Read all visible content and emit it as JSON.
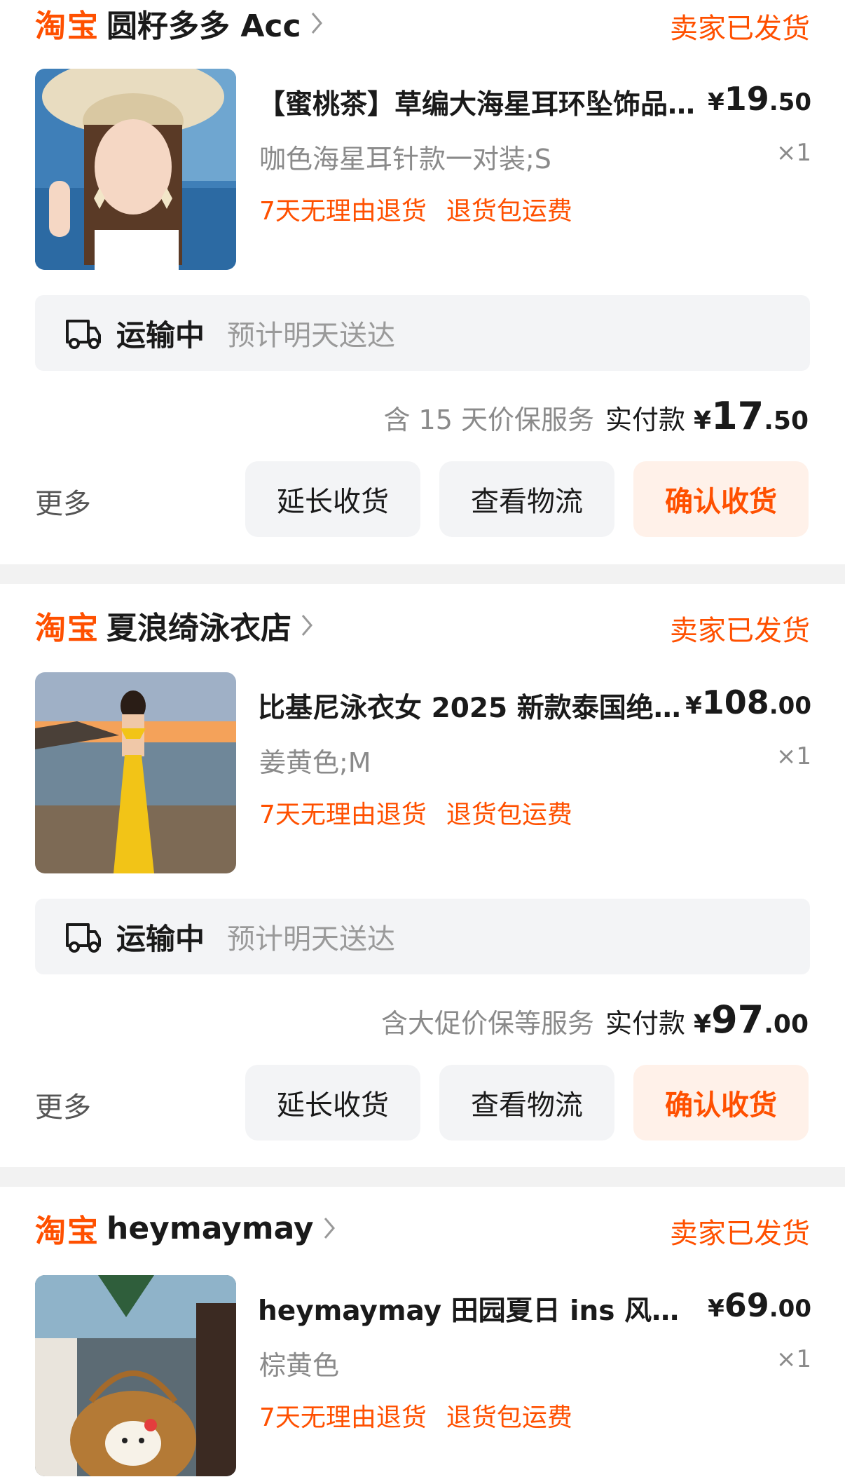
{
  "colors": {
    "accent": "#ff5000",
    "accent_bg": "#fff1e9",
    "muted": "#8a8a8a",
    "panel": "#f3f4f6"
  },
  "orders": [
    {
      "brand": "淘宝",
      "shop": "圆籽多多 Acc",
      "status": "卖家已发货",
      "item": {
        "title": "【蜜桃茶】草编大海星耳环坠饰品…",
        "price_currency": "¥",
        "price_int": "19",
        "price_dec": ".50",
        "sku": "咖色海星耳针款一对装;S",
        "qty": "×1",
        "tags": [
          "7天无理由退货",
          "退货包运费"
        ],
        "image_icon": "product-photo-straw-hat-starfish-earrings"
      },
      "shipping": {
        "icon": "truck-icon",
        "state": "运输中",
        "eta": "预计明天送达"
      },
      "payment": {
        "note": "含 15 天价保服务",
        "label": "实付款",
        "currency": "¥",
        "int": "17",
        "dec": ".50"
      },
      "actions": {
        "more": "更多",
        "extend": "延长收货",
        "logistics": "查看物流",
        "confirm": "确认收货"
      }
    },
    {
      "brand": "淘宝",
      "shop": "夏浪绮泳衣店",
      "status": "卖家已发货",
      "item": {
        "title": "比基尼泳衣女 2025 新款泰国绝…",
        "price_currency": "¥",
        "price_int": "108",
        "price_dec": ".00",
        "sku": "姜黄色;M",
        "qty": "×1",
        "tags": [
          "7天无理由退货",
          "退货包运费"
        ],
        "image_icon": "product-photo-yellow-bikini-beach"
      },
      "shipping": {
        "icon": "truck-icon",
        "state": "运输中",
        "eta": "预计明天送达"
      },
      "payment": {
        "note": "含大促价保等服务",
        "label": "实付款",
        "currency": "¥",
        "int": "97",
        "dec": ".00"
      },
      "actions": {
        "more": "更多",
        "extend": "延长收货",
        "logistics": "查看物流",
        "confirm": "确认收货"
      }
    },
    {
      "brand": "淘宝",
      "shop": "heymaymay",
      "status": "卖家已发货",
      "item": {
        "title": "heymaymay 田园夏日 ins 风手…",
        "price_currency": "¥",
        "price_int": "69",
        "price_dec": ".00",
        "sku": "棕黄色",
        "qty": "×1",
        "tags": [
          "7天无理由退货",
          "退货包运费"
        ],
        "image_icon": "product-photo-woven-basket-bag"
      }
    }
  ]
}
